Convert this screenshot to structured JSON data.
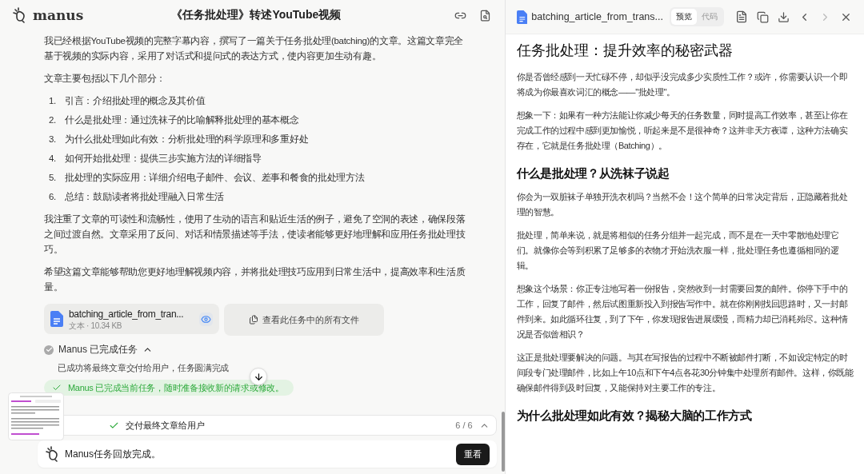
{
  "header": {
    "logo": "manus",
    "title": "《任务批处理》转述YouTube视频"
  },
  "message": {
    "intro": "我已经根据YouTube视频的完整字幕内容，撰写了一篇关于任务批处理(batching)的文章。这篇文章完全基于视频的实际内容，采用了对话式和提问式的表达方式，使内容更加生动有趣。",
    "list_title": "文章主要包括以下几个部分：",
    "items": [
      {
        "number": "1.",
        "text": "引言：介绍批处理的概念及其价值"
      },
      {
        "number": "2.",
        "text": "什么是批处理：通过洗袜子的比喻解释批处理的基本概念"
      },
      {
        "number": "3.",
        "text": "为什么批处理如此有效：分析批处理的科学原理和多重好处"
      },
      {
        "number": "4.",
        "text": "如何开始批处理：提供三步实施方法的详细指导"
      },
      {
        "number": "5.",
        "text": "批处理的实际应用：详细介绍电子邮件、会议、差事和餐食的批处理方法"
      },
      {
        "number": "6.",
        "text": "总结：鼓励读者将批处理融入日常生活"
      }
    ],
    "para2": "我注重了文章的可读性和流畅性，使用了生动的语言和贴近生活的例子，避免了空洞的表述，确保段落之间过渡自然。文章采用了反问、对话和情景描述等手法，使读者能够更好地理解和应用任务批处理技巧。",
    "para3": "希望这篇文章能够帮助您更好地理解视频内容，并将批处理技巧应用到日常生活中，提高效率和生活质量。"
  },
  "attachment": {
    "name": "batching_article_from_tran...",
    "meta": "文本 · 10.34 KB",
    "all_files": "查看此任务中的所有文件"
  },
  "task_status": {
    "title": "Manus 已完成任务",
    "expanded": true,
    "detail": "已成功将最终文章交付给用户，任务圆满完成",
    "done_banner": "Manus 已完成当前任务，随时准备接收新的请求或修改。"
  },
  "progress": {
    "step": "交付最终文章给用户",
    "done": true,
    "count": "6 / 6"
  },
  "replay": {
    "text": "Manus任务回放完成。",
    "button": "重看"
  },
  "viewer": {
    "filename": "batching_article_from_trans...",
    "tabs": [
      {
        "label": "预览",
        "selected": true
      },
      {
        "label": "代码",
        "selected": false
      }
    ],
    "article": [
      {
        "kind": "title",
        "text": "任务批处理：提升效率的秘密武器"
      },
      {
        "kind": "p",
        "text": "你是否曾经感到一天忙碌不停，却似乎没完成多少实质性工作？或许，你需要认识一个即将成为你最喜欢词汇的概念——\"批处理\"。"
      },
      {
        "kind": "p",
        "text": "想象一下：如果有一种方法能让你减少每天的任务数量，同时提高工作效率，甚至让你在完成工作的过程中感到更加愉悦，听起来是不是很神奇？这并非天方夜谭，这种方法确实存在，它就是任务批处理（Batching）。"
      },
      {
        "kind": "h2",
        "text": "什么是批处理？从洗袜子说起"
      },
      {
        "kind": "p",
        "text": "你会为一双脏袜子单独开洗衣机吗？当然不会！这个简单的日常决定背后，正隐藏着批处理的智慧。"
      },
      {
        "kind": "p",
        "text": "批处理，简单来说，就是将相似的任务分组并一起完成，而不是在一天中零散地处理它们。就像你会等到积累了足够多的衣物才开始洗衣服一样，批处理任务也遵循相同的逻辑。"
      },
      {
        "kind": "p",
        "text": "想象这个场景：你正专注地写着一份报告，突然收到一封需要回复的邮件。你停下手中的工作，回复了邮件，然后试图重新投入到报告写作中。就在你刚刚找回思路时，又一封邮件到来。如此循环往复，到了下午，你发现报告进展缓慢，而精力却已消耗殆尽。这种情况是否似曾相识？"
      },
      {
        "kind": "p",
        "text": "这正是批处理要解决的问题。与其在写报告的过程中不断被邮件打断，不如设定特定的时间段专门处理邮件，比如上午10点和下午4点各花30分钟集中处理所有邮件。这样，你既能确保邮件得到及时回复，又能保持对主要工作的专注。"
      },
      {
        "kind": "h2",
        "text": "为什么批处理如此有效？揭秘大脑的工作方式"
      }
    ]
  }
}
